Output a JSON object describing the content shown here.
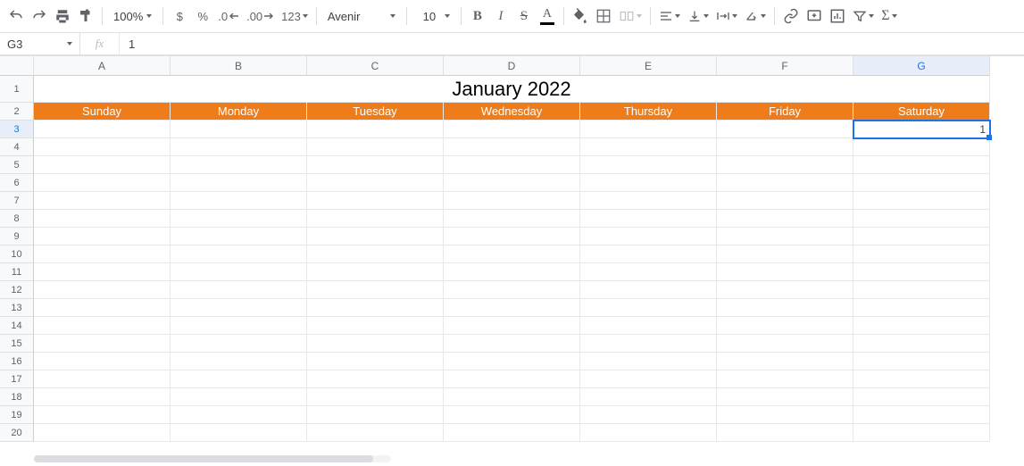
{
  "toolbar": {
    "zoom": "100%",
    "currency": "$",
    "percent": "%",
    "dec_dec": ".0",
    "inc_dec": ".00",
    "more_formats": "123",
    "font": "Avenir",
    "font_size": "10",
    "bold": "B",
    "italic": "I",
    "strike": "S",
    "text_color_letter": "A",
    "functions": "Σ"
  },
  "formula": {
    "name_box": "G3",
    "fx_label": "fx",
    "value": "1"
  },
  "columns": [
    "A",
    "B",
    "C",
    "D",
    "E",
    "F",
    "G"
  ],
  "active_column_index": 6,
  "active_row": 3,
  "row_count": 20,
  "sheet": {
    "title": "January 2022",
    "day_headers": [
      "Sunday",
      "Monday",
      "Tuesday",
      "Wednesday",
      "Thursday",
      "Friday",
      "Saturday"
    ],
    "g3_value": "1"
  },
  "colors": {
    "day_header_bg": "#ef7c1a",
    "selection": "#1a73e8"
  }
}
